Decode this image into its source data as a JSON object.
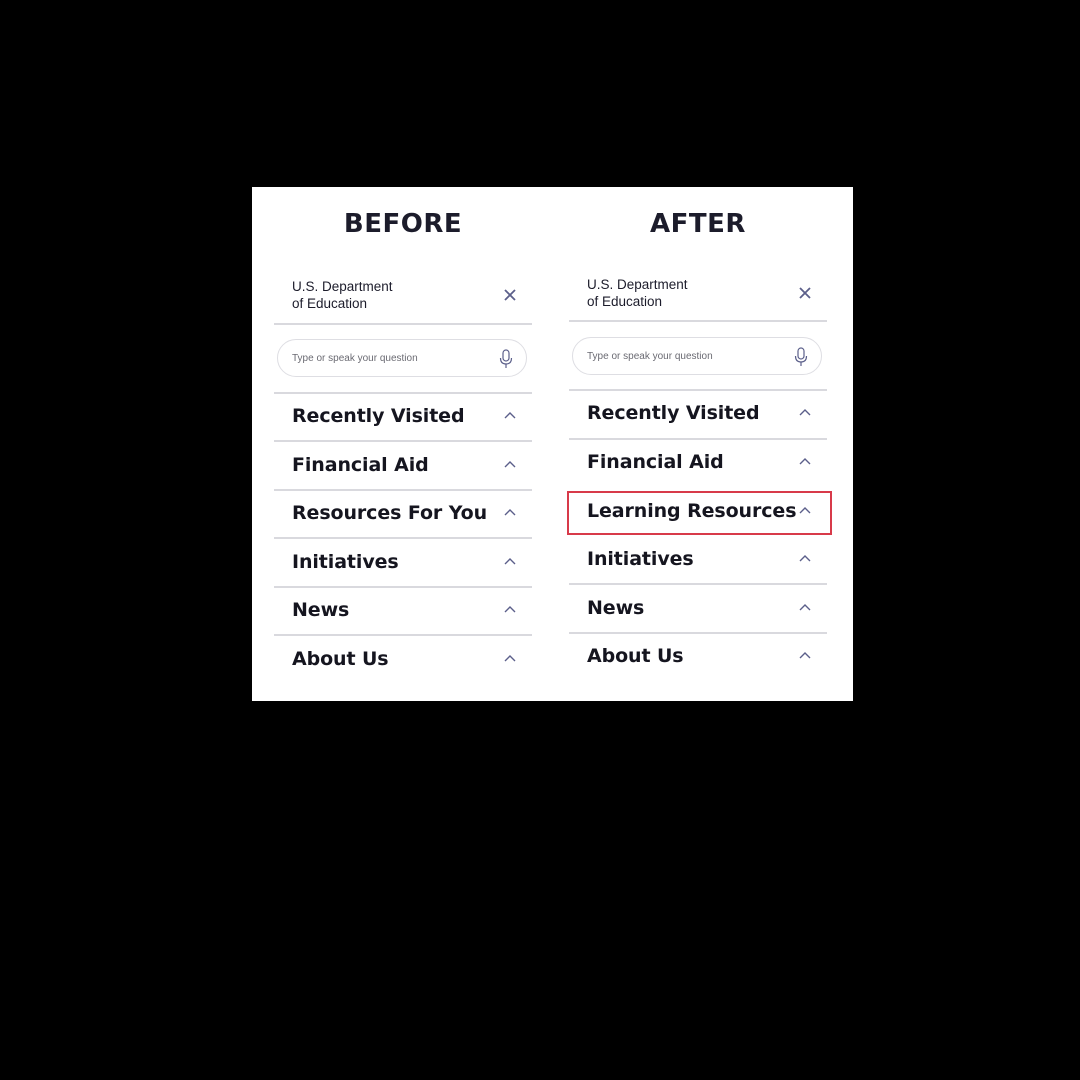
{
  "before": {
    "heading": "BEFORE",
    "brand_line1": "U.S. Department",
    "brand_line2": "of Education",
    "search_placeholder": "Type or speak your question",
    "items": [
      "Recently Visited",
      "Financial Aid",
      "Resources For You",
      "Initiatives",
      "News",
      "About Us"
    ]
  },
  "after": {
    "heading": "AFTER",
    "brand_line1": "U.S. Department",
    "brand_line2": "of Education",
    "search_placeholder": "Type or speak your question",
    "items": [
      "Recently Visited",
      "Financial Aid",
      "Learning Resources",
      "Initiatives",
      "News",
      "About Us"
    ],
    "highlighted_item": "Learning Resources"
  },
  "colors": {
    "highlight": "#d83a4a",
    "icon": "#5b5f8a"
  },
  "icons": {
    "close": "close-icon",
    "mic": "microphone-icon",
    "chevron": "chevron-up-icon"
  }
}
